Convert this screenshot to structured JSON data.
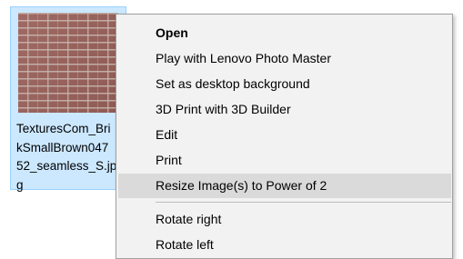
{
  "file": {
    "name_lines": [
      "TexturesCom_Bri",
      "kSmallBrown047",
      "52_seamless_S.jp",
      "g"
    ]
  },
  "context_menu": {
    "items": [
      {
        "label": "Open"
      },
      {
        "label": "Play with Lenovo Photo Master"
      },
      {
        "label": "Set as desktop background"
      },
      {
        "label": "3D Print with 3D Builder"
      },
      {
        "label": "Edit"
      },
      {
        "label": "Print"
      },
      {
        "label": "Resize Image(s) to Power of 2"
      },
      {
        "label": "Rotate right"
      },
      {
        "label": "Rotate left"
      }
    ]
  },
  "colors": {
    "selection_fill": "#cce8ff",
    "selection_border": "#99d1ff",
    "menu_background": "#f2f2f2",
    "menu_highlight": "#dadada"
  }
}
